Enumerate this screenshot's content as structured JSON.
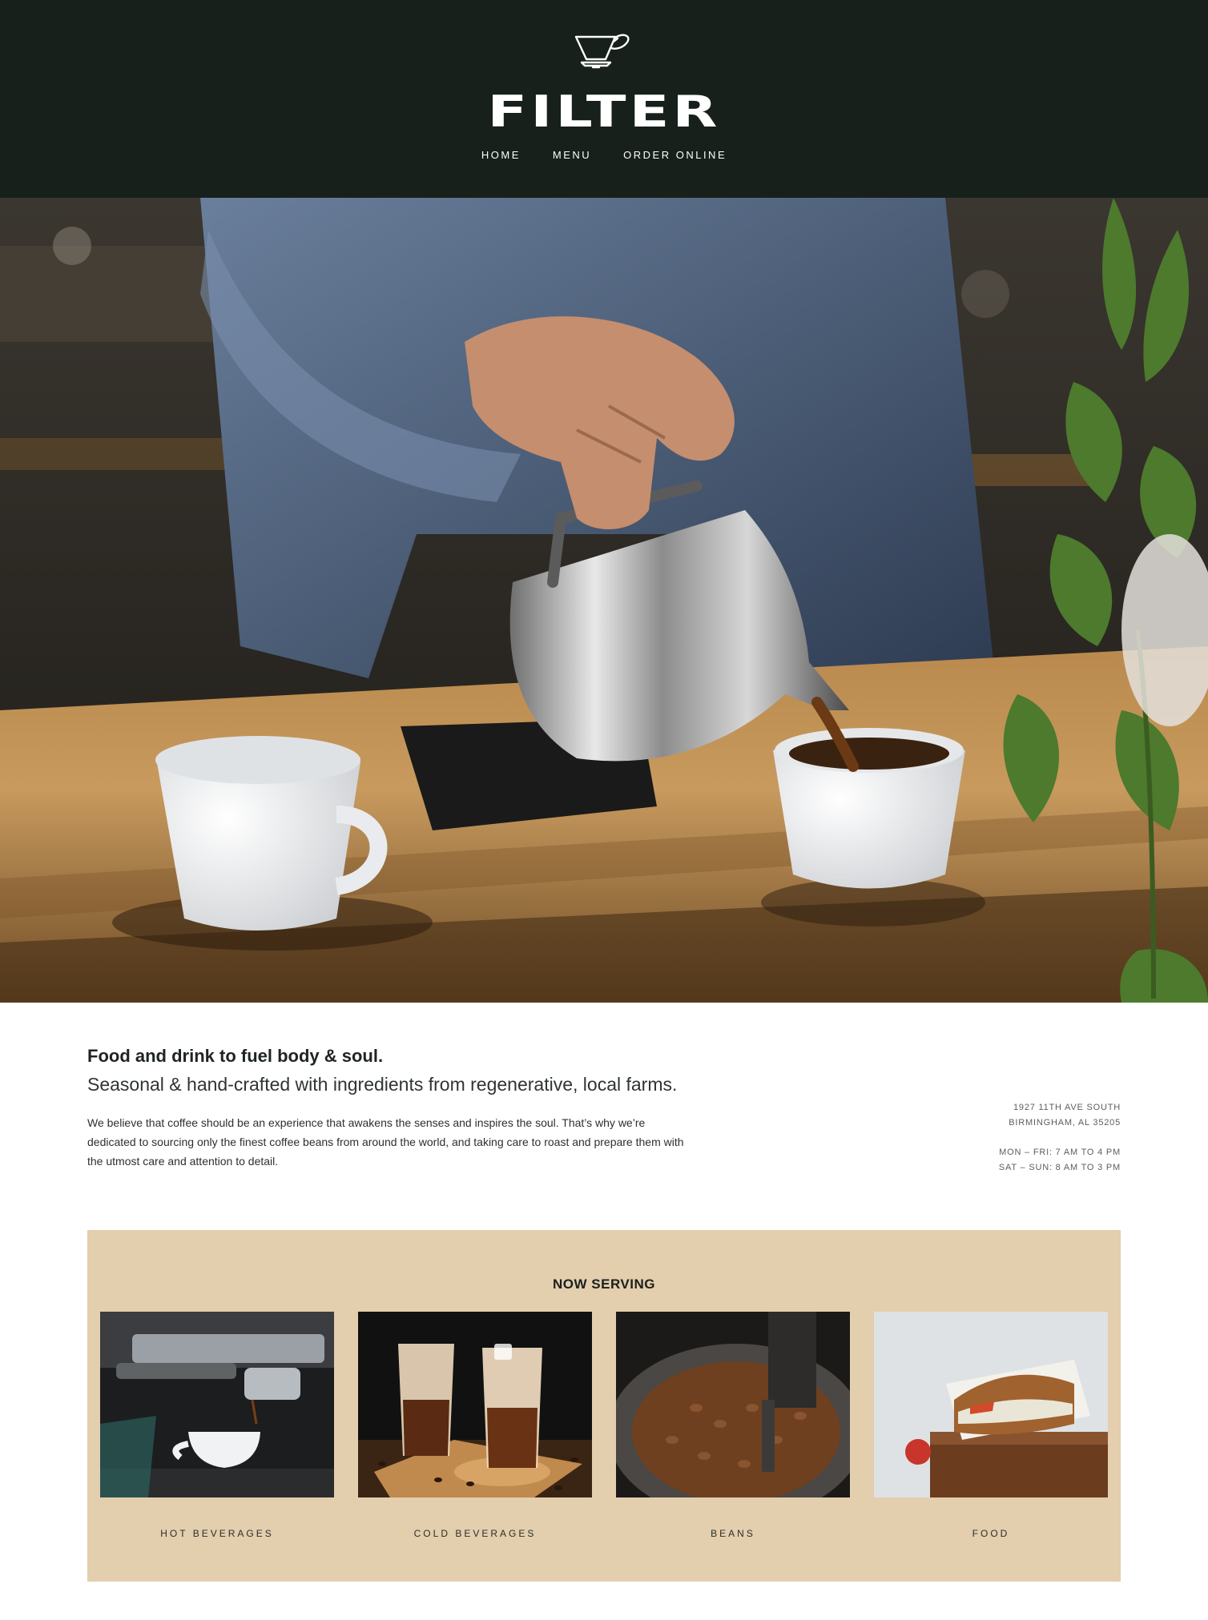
{
  "header": {
    "logo_icon": "pour-over-dripper-icon",
    "brand": "FILTER",
    "nav": [
      {
        "label": "HOME"
      },
      {
        "label": "MENU"
      },
      {
        "label": "ORDER ONLINE"
      }
    ],
    "background": "#17201b"
  },
  "hero": {
    "image": "barista-pouring-coffee-from-steel-pitcher-into-white-cup"
  },
  "intro": {
    "tagline": "Food and drink to fuel body & soul.",
    "subtagline": "Seasonal & hand-crafted with ingredients from regenerative, local farms.",
    "body": "We believe that coffee should be an experience that awakens the senses and inspires the soul. That’s why we’re dedicated to sourcing only the finest coffee beans from around the world, and taking care to roast and prepare them with the utmost care and attention to detail."
  },
  "info": {
    "address_line1": "1927 11TH AVE SOUTH",
    "address_line2": "BIRMINGHAM, AL 35205",
    "hours_weekday": "MON – FRI: 7 AM TO 4 PM",
    "hours_weekend": "SAT – SUN: 8 AM TO 3 PM"
  },
  "serving": {
    "title": "NOW SERVING",
    "background": "#e3cead",
    "cards": [
      {
        "label": "HOT BEVERAGES",
        "image": "espresso-machine-pouring-into-cup"
      },
      {
        "label": "COLD BEVERAGES",
        "image": "iced-coffee-glasses"
      },
      {
        "label": "BEANS",
        "image": "coffee-bean-roaster"
      },
      {
        "label": "FOOD",
        "image": "grilled-sandwich"
      }
    ]
  }
}
